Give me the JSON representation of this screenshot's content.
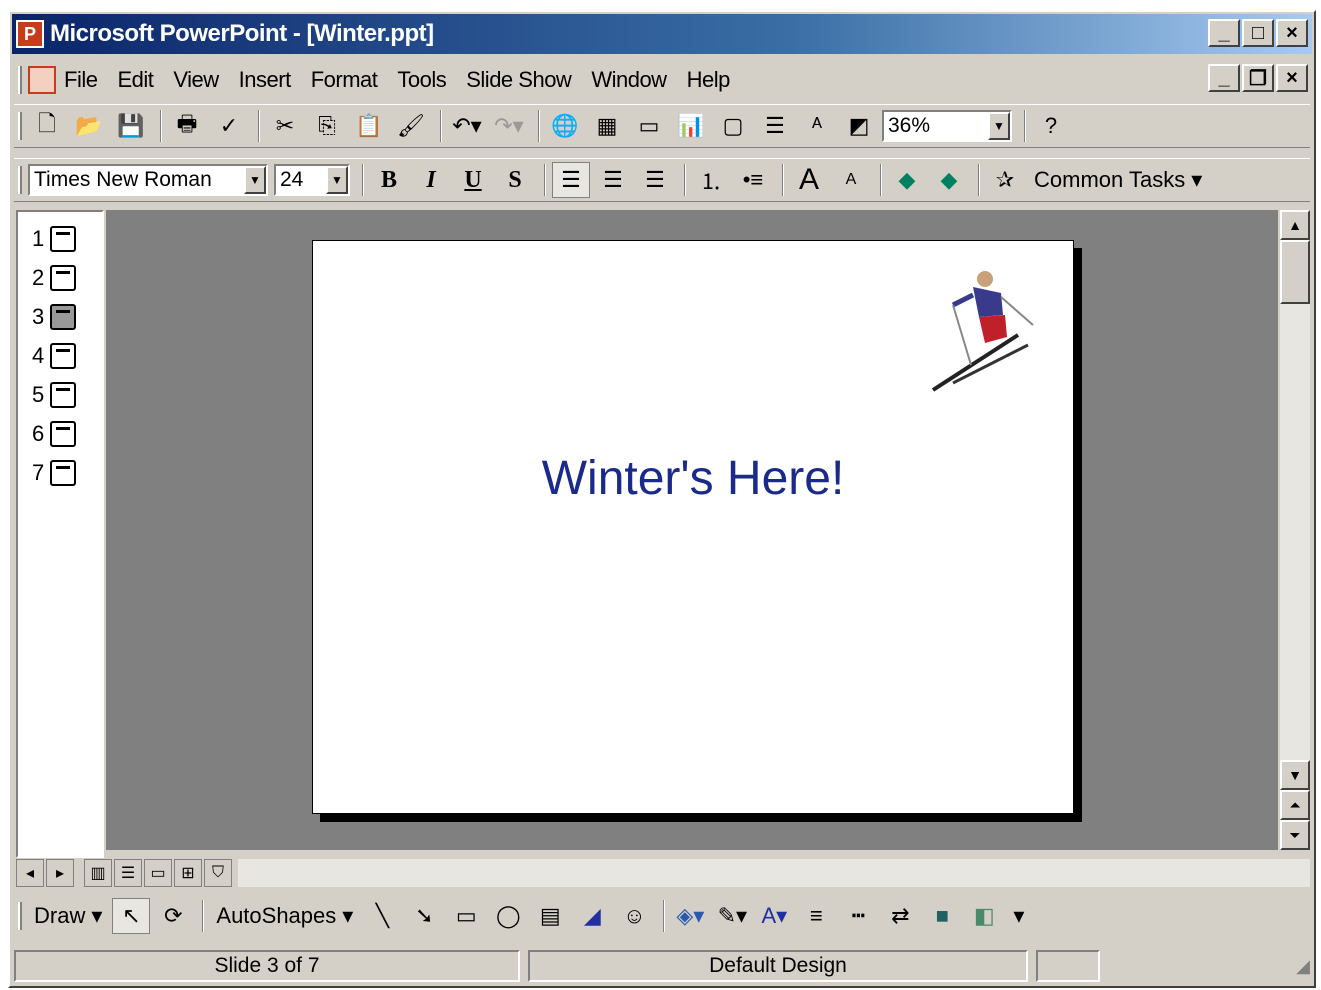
{
  "window": {
    "title": "Microsoft PowerPoint - [Winter.ppt]",
    "caption_buttons": [
      "_",
      "□",
      "×"
    ],
    "doc_buttons": [
      "_",
      "❐",
      "×"
    ]
  },
  "menu": {
    "items": [
      "File",
      "Edit",
      "View",
      "Insert",
      "Format",
      "Tools",
      "Slide Show",
      "Window",
      "Help"
    ]
  },
  "standard_toolbar": {
    "zoom": "36%",
    "help": "?"
  },
  "formatting_toolbar": {
    "font": "Times New Roman",
    "size": "24",
    "bold": "B",
    "italic": "I",
    "underline": "U",
    "shadow": "S",
    "common_tasks": "Common Tasks"
  },
  "outline": {
    "slides": [
      "1",
      "2",
      "3",
      "4",
      "5",
      "6",
      "7"
    ],
    "selected_index": 3
  },
  "slide": {
    "title": "Winter's Here!"
  },
  "drawing_toolbar": {
    "draw": "Draw",
    "autoshapes": "AutoShapes"
  },
  "status": {
    "slide_position": "Slide 3 of 7",
    "design": "Default Design"
  }
}
